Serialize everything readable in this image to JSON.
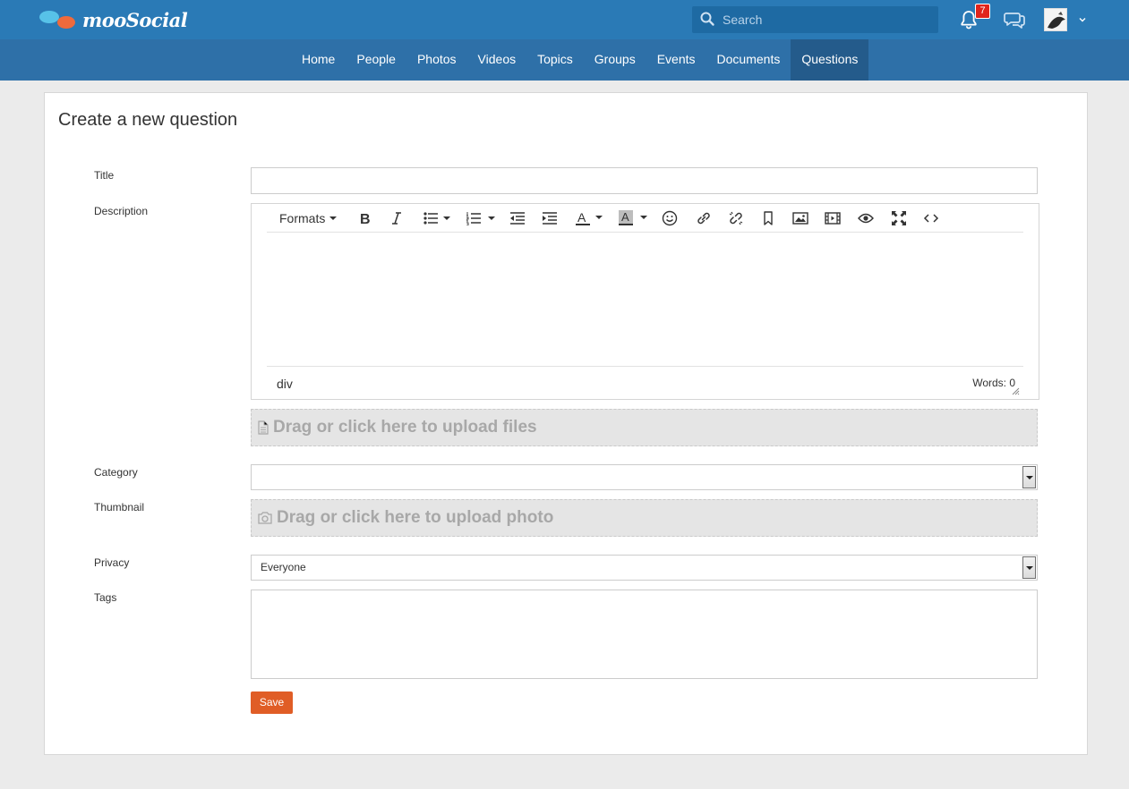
{
  "header": {
    "logo_text": "mooSocial",
    "search_placeholder": "Search",
    "notification_count": "7"
  },
  "nav": {
    "items": [
      {
        "label": "Home"
      },
      {
        "label": "People"
      },
      {
        "label": "Photos"
      },
      {
        "label": "Videos"
      },
      {
        "label": "Topics"
      },
      {
        "label": "Groups"
      },
      {
        "label": "Events"
      },
      {
        "label": "Documents"
      },
      {
        "label": "Questions"
      }
    ],
    "active": "Questions"
  },
  "form": {
    "page_title": "Create a new question",
    "labels": {
      "title": "Title",
      "description": "Description",
      "category": "Category",
      "thumbnail": "Thumbnail",
      "privacy": "Privacy",
      "tags": "Tags"
    },
    "title_value": "",
    "editor": {
      "formats_label": "Formats",
      "path": "div",
      "word_count": "Words: 0"
    },
    "file_upload_text": "Drag or click here to upload files",
    "category_value": "",
    "photo_upload_text": "Drag or click here to upload photo",
    "privacy_value": "Everyone",
    "tags_value": "",
    "save_label": "Save"
  },
  "colors": {
    "topbar": "#2a7ab6",
    "navbar": "#2e70a8",
    "nav_active": "#245b8b",
    "save_button": "#e05d26",
    "badge": "#e0241b"
  }
}
